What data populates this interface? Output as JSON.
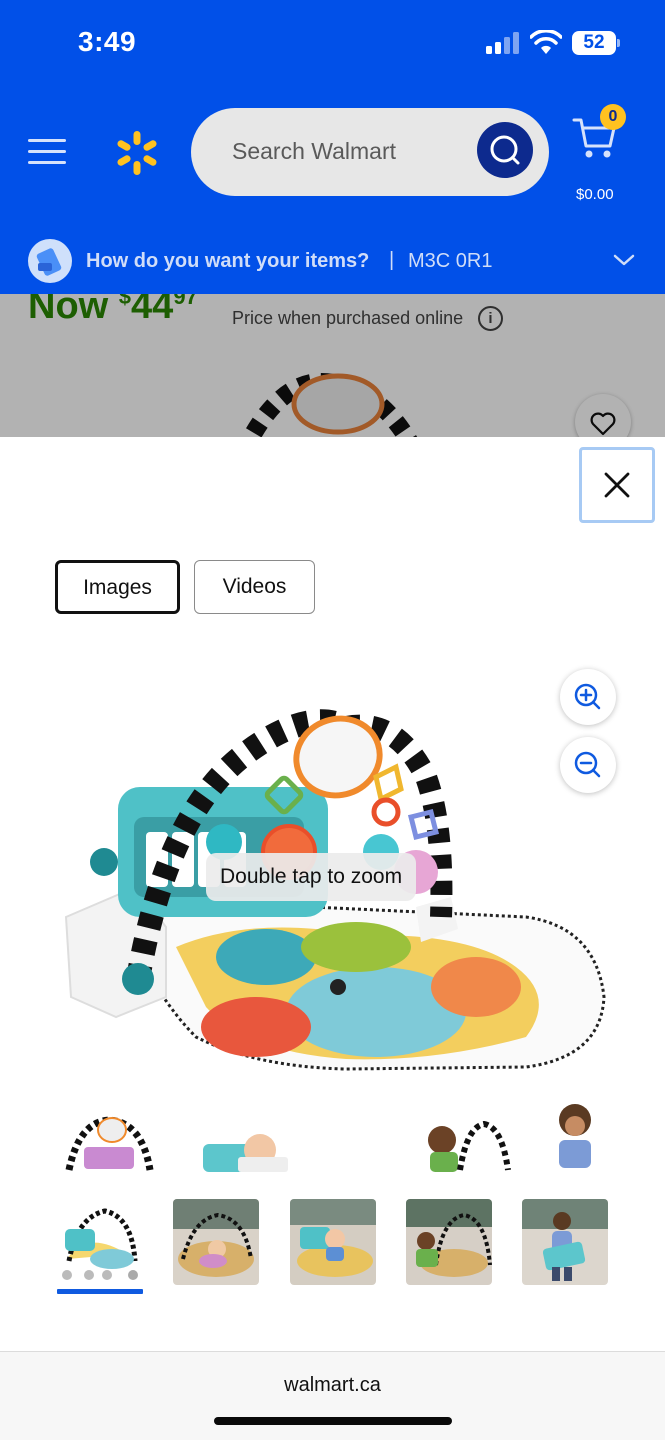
{
  "status_bar": {
    "time": "3:49",
    "battery": "52"
  },
  "header": {
    "search_placeholder": "Search Walmart",
    "cart_count": "0",
    "cart_total": "$0.00",
    "delivery_question": "How do you want your items?",
    "delivery_separator": "|",
    "postal_code": "M3C 0R1"
  },
  "product": {
    "price_prefix": "Now",
    "price_dollars": "44",
    "price_cents": "97",
    "price_note": "Price when purchased online",
    "info_symbol": "i"
  },
  "viewer": {
    "tabs": [
      {
        "label": "Images",
        "selected": true
      },
      {
        "label": "Videos",
        "selected": false
      }
    ],
    "zoom_hint": "Double tap to zoom",
    "thumbnail_count": 5,
    "selected_thumbnail": 1
  },
  "browser": {
    "url": "walmart.ca"
  },
  "colors": {
    "brand_blue": "#0150e8",
    "spark_yellow": "#ffc220",
    "price_green": "#2a8703",
    "selected_underline": "#0f5ae0"
  }
}
